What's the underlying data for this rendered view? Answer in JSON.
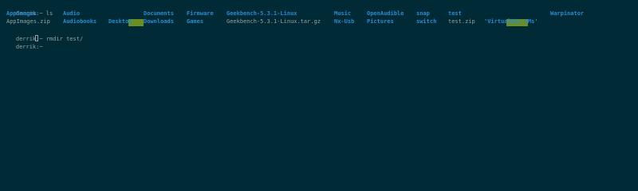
{
  "terminal": {
    "bg": "#002b36",
    "colors": {
      "directory": "#268bd2",
      "file": "#93a1a1",
      "highlight_bg": "#6b8e23"
    },
    "prompt_1": "derrik:~ ",
    "command_1": "ls",
    "ls_row_1": [
      {
        "name": "AppImages",
        "type": "dir"
      },
      {
        "name": "Audio",
        "type": "dir"
      },
      {
        "name": "",
        "type": "highlight-dir"
      },
      {
        "name": "Documents",
        "type": "dir"
      },
      {
        "name": "Firmware",
        "type": "dir"
      },
      {
        "name": "Geekbench-5.3.1-Linux",
        "type": "dir"
      },
      {
        "name": "Music",
        "type": "dir"
      },
      {
        "name": "OpenAudible",
        "type": "dir"
      },
      {
        "name": "snap",
        "type": "dir"
      },
      {
        "name": "test",
        "type": "dir"
      },
      {
        "name": "",
        "type": "highlight-dir"
      },
      {
        "name": "Warpinator",
        "type": "dir"
      }
    ],
    "ls_row_2": [
      {
        "name": "AppImages.zip",
        "type": "file"
      },
      {
        "name": "Audiobooks",
        "type": "dir"
      },
      {
        "name": "Desktop",
        "type": "dir"
      },
      {
        "name": "Downloads",
        "type": "dir"
      },
      {
        "name": "Games",
        "type": "dir"
      },
      {
        "name": "Geekbench-5.3.1-Linux.tar.gz",
        "type": "file"
      },
      {
        "name": "Nx-Usb",
        "type": "dir"
      },
      {
        "name": "Pictures",
        "type": "dir"
      },
      {
        "name": "switch",
        "type": "dir"
      },
      {
        "name": "test.zip",
        "type": "file"
      },
      {
        "name": "'VirtualBox VMs'",
        "type": "dir"
      }
    ],
    "prompt_2": "derrik:~ ",
    "command_2": "rmdir test/",
    "prompt_3": "derrik:~ "
  }
}
